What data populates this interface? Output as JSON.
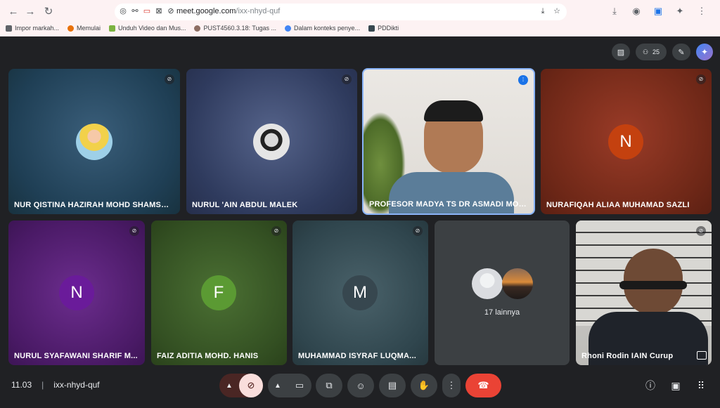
{
  "browser": {
    "url_host": "meet.google.com",
    "url_path": "/ixx-nhyd-quf",
    "bookmarks": [
      {
        "label": "Impor markah...",
        "color": "#5f6368"
      },
      {
        "label": "Memulai",
        "color": "#e8710a"
      },
      {
        "label": "Unduh Video dan Mus...",
        "color": "#7cb342"
      },
      {
        "label": "PUST4560.3.18: Tugas ...",
        "color": "#8d6e63"
      },
      {
        "label": "Dalam konteks penye...",
        "color": "#4285f4"
      },
      {
        "label": "PDDikti",
        "color": "#37474f"
      }
    ]
  },
  "meeting": {
    "participant_count": "25",
    "time": "11.03",
    "code": "ixx-nhyd-quf",
    "others_label": "17 lainnya"
  },
  "tiles": [
    {
      "name": "NUR QISTINA HAZIRAH MOHD SHAMSU..."
    },
    {
      "name": "NURUL 'AIN ABDUL MALEK"
    },
    {
      "name": "PROFESOR MADYA TS DR ASMADI MOH..."
    },
    {
      "name": "NURAFIQAH ALIAA MUHAMAD SAZLI",
      "initial": "N"
    },
    {
      "name": "NURUL SYAFAWANI SHARIF M...",
      "initial": "N"
    },
    {
      "name": "FAIZ ADITIA MOHD. HANIS",
      "initial": "F"
    },
    {
      "name": "MUHAMMAD ISYRAF LUQMA...",
      "initial": "M"
    },
    {
      "name": "Rhoni Rodin IAIN Curup"
    }
  ],
  "colors": {
    "end_call": "#ea4335",
    "mic_off_active": "#f9dedc",
    "active_border": "#8ab4f8"
  }
}
